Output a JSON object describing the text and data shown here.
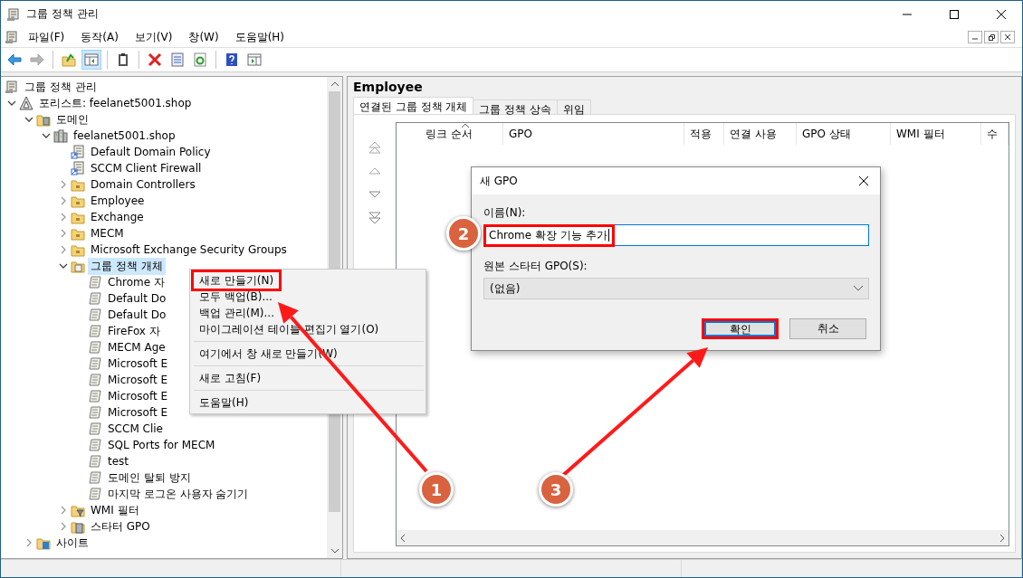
{
  "window": {
    "title": "그룹 정책 관리"
  },
  "menu": [
    "파일(F)",
    "동작(A)",
    "보기(V)",
    "창(W)",
    "도움말(H)"
  ],
  "toolbar": [
    {
      "kind": "back",
      "disabled": false,
      "pressed": false
    },
    {
      "kind": "forward",
      "disabled": true,
      "pressed": false
    },
    {
      "kind": "sep"
    },
    {
      "kind": "up",
      "disabled": false,
      "pressed": false
    },
    {
      "kind": "tree",
      "disabled": false,
      "pressed": true
    },
    {
      "kind": "sep"
    },
    {
      "kind": "clipboard",
      "disabled": false,
      "pressed": false
    },
    {
      "kind": "sep"
    },
    {
      "kind": "delete",
      "disabled": false,
      "pressed": false
    },
    {
      "kind": "properties",
      "disabled": false,
      "pressed": false
    },
    {
      "kind": "refresh",
      "disabled": false,
      "pressed": false
    },
    {
      "kind": "sep"
    },
    {
      "kind": "help",
      "disabled": false,
      "pressed": false
    },
    {
      "kind": "action",
      "disabled": false,
      "pressed": false
    }
  ],
  "tree": [
    {
      "label": "그룹 정책 관리",
      "kind": "root",
      "selected": false,
      "children": [
        {
          "label": "포리스트: feelanet5001.shop",
          "kind": "forest",
          "expanded": true,
          "selected": false,
          "children": [
            {
              "label": "도메인",
              "kind": "domains",
              "expanded": true,
              "selected": false,
              "children": [
                {
                  "label": "feelanet5001.shop",
                  "kind": "domain",
                  "expanded": true,
                  "selected": false,
                  "children": [
                    {
                      "label": "Default Domain Policy",
                      "kind": "link",
                      "selected": false
                    },
                    {
                      "label": "SCCM Client Firewall",
                      "kind": "link",
                      "selected": false
                    },
                    {
                      "label": "Domain Controllers",
                      "kind": "ou",
                      "expanded": false,
                      "selected": false
                    },
                    {
                      "label": "Employee",
                      "kind": "ou",
                      "expanded": false,
                      "selected": false
                    },
                    {
                      "label": "Exchange",
                      "kind": "ou",
                      "expanded": false,
                      "selected": false
                    },
                    {
                      "label": "MECM",
                      "kind": "ou",
                      "expanded": false,
                      "selected": false
                    },
                    {
                      "label": "Microsoft Exchange Security Groups",
                      "kind": "ou",
                      "expanded": false,
                      "selected": false
                    },
                    {
                      "label": "그룹 정책 개체",
                      "kind": "gpofolder",
                      "expanded": true,
                      "selected": true,
                      "children": [
                        {
                          "label": "Chrome 자",
                          "kind": "gpo",
                          "selected": false
                        },
                        {
                          "label": "Default Do",
                          "kind": "gpo",
                          "selected": false
                        },
                        {
                          "label": "Default Do",
                          "kind": "gpo",
                          "selected": false
                        },
                        {
                          "label": "FireFox 자",
                          "kind": "gpo",
                          "selected": false
                        },
                        {
                          "label": "MECM Age",
                          "kind": "gpo",
                          "selected": false
                        },
                        {
                          "label": "Microsoft E",
                          "kind": "gpo",
                          "selected": false
                        },
                        {
                          "label": "Microsoft E",
                          "kind": "gpo",
                          "selected": false
                        },
                        {
                          "label": "Microsoft E",
                          "kind": "gpo",
                          "selected": false
                        },
                        {
                          "label": "Microsoft E",
                          "kind": "gpo",
                          "selected": false
                        },
                        {
                          "label": "SCCM Clie",
                          "kind": "gpo",
                          "selected": false
                        },
                        {
                          "label": "SQL Ports for MECM",
                          "kind": "gpo",
                          "selected": false
                        },
                        {
                          "label": "test",
                          "kind": "gpo",
                          "selected": false
                        },
                        {
                          "label": "도메인 탈퇴 방지",
                          "kind": "gpo",
                          "selected": false
                        },
                        {
                          "label": "마지막 로그온 사용자 숨기기",
                          "kind": "gpo",
                          "selected": false
                        }
                      ]
                    },
                    {
                      "label": "WMI 필터",
                      "kind": "wmi",
                      "expanded": false,
                      "selected": false
                    },
                    {
                      "label": "스타터 GPO",
                      "kind": "starter",
                      "expanded": false,
                      "selected": false
                    }
                  ]
                }
              ]
            },
            {
              "label": "사이트",
              "kind": "site",
              "expanded": false,
              "selected": false
            }
          ]
        }
      ]
    }
  ],
  "pane": {
    "title": "Employee",
    "tabs": [
      {
        "label": "연결된 그룹 정책 개체",
        "selected": true
      },
      {
        "label": "그룹 정책 상속",
        "selected": false
      },
      {
        "label": "위임",
        "selected": false
      }
    ],
    "columns": [
      {
        "label": "링크 순서",
        "sorted": true
      },
      {
        "label": "GPO",
        "sorted": false
      },
      {
        "label": "적용",
        "sorted": false
      },
      {
        "label": "연결 사용",
        "sorted": false
      },
      {
        "label": "GPO 상태",
        "sorted": false
      },
      {
        "label": "WMI 필터",
        "sorted": false
      },
      {
        "label": "수",
        "sorted": false
      }
    ]
  },
  "context_menu": {
    "groups": [
      [
        {
          "label": "새로 만들기(N)",
          "highlighted": true
        },
        {
          "label": "모두 백업(B)...",
          "highlighted": false
        },
        {
          "label": "백업 관리(M)...",
          "highlighted": false
        },
        {
          "label": "마이그레이션 테이블 편집기 열기(O)",
          "highlighted": false
        }
      ],
      [
        {
          "label": "여기에서 창 새로 만들기(W)",
          "highlighted": false
        }
      ],
      [
        {
          "label": "새로 고침(F)",
          "highlighted": false
        }
      ],
      [
        {
          "label": "도움말(H)",
          "highlighted": false
        }
      ]
    ]
  },
  "dialog": {
    "title": "새 GPO",
    "name_label": "이름(N):",
    "name_value": "Chrome 확장 기능 추가",
    "name_highlighted": true,
    "starter_label": "원본 스타터 GPO(S):",
    "starter_value": "(없음)",
    "buttons": [
      {
        "label": "확인",
        "default": true,
        "highlighted": true
      },
      {
        "label": "취소",
        "default": false,
        "highlighted": false
      }
    ]
  },
  "markers": [
    {
      "label": "1"
    },
    {
      "label": "2"
    },
    {
      "label": "3"
    }
  ]
}
